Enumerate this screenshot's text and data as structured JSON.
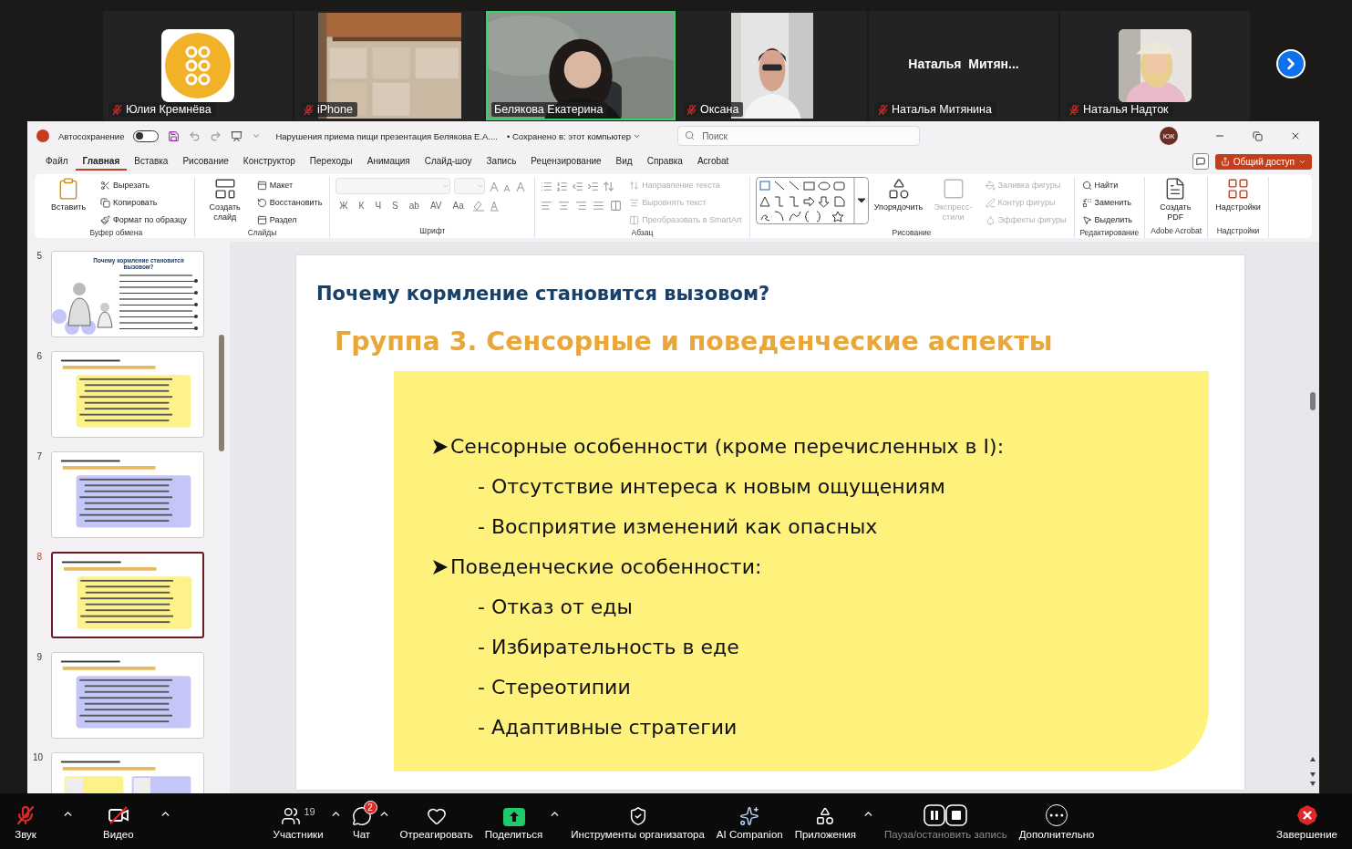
{
  "participants": [
    {
      "name": "Юлия Кремнёва",
      "kind": "logo_avatar",
      "muted": true,
      "speaking": false
    },
    {
      "name": "iPhone",
      "kind": "wide_camera",
      "muted": true,
      "speaking": false
    },
    {
      "name": "Белякова Екатерина",
      "kind": "video",
      "muted": false,
      "speaking": true
    },
    {
      "name": "Оксана",
      "kind": "narrow_camera",
      "muted": true,
      "speaking": false
    },
    {
      "name": "Наталья Митянина",
      "kind": "name_only",
      "display_name": "Наталья  Митян...",
      "muted": true,
      "speaking": false
    },
    {
      "name": "Наталья Надток",
      "kind": "photo_avatar",
      "muted": true,
      "speaking": false
    }
  ],
  "powerpoint": {
    "autosave_label": "Автосохранение",
    "autosave_on": false,
    "doc_title": "Нарушения приема пищи презентация Белякова Е.А....",
    "save_status": "• Сохранено в: этот компьютер",
    "search_placeholder": "Поиск",
    "user_initials": "ЮК",
    "tabs": [
      {
        "label": "Файл",
        "selected": false
      },
      {
        "label": "Главная",
        "selected": true
      },
      {
        "label": "Вставка",
        "selected": false
      },
      {
        "label": "Рисование",
        "selected": false
      },
      {
        "label": "Конструктор",
        "selected": false
      },
      {
        "label": "Переходы",
        "selected": false
      },
      {
        "label": "Анимация",
        "selected": false
      },
      {
        "label": "Слайд-шоу",
        "selected": false
      },
      {
        "label": "Запись",
        "selected": false
      },
      {
        "label": "Рецензирование",
        "selected": false
      },
      {
        "label": "Вид",
        "selected": false
      },
      {
        "label": "Справка",
        "selected": false
      },
      {
        "label": "Acrobat",
        "selected": false
      }
    ],
    "share_button": "Общий доступ",
    "ribbon_groups": [
      {
        "kind": "standard",
        "label": "Буфер обмена",
        "items": [
          {
            "kind": "large",
            "label": "Вставить",
            "disabled": false
          },
          {
            "kind": "small",
            "label": "Вырезать",
            "disabled": false
          },
          {
            "kind": "small",
            "label": "Копировать",
            "disabled": false
          },
          {
            "kind": "small",
            "label": "Формат по образцу",
            "disabled": false
          }
        ]
      },
      {
        "kind": "standard",
        "label": "Слайды",
        "items": [
          {
            "kind": "large",
            "label": "Создать слайд",
            "disabled": false
          },
          {
            "kind": "small",
            "label": "Макет",
            "disabled": false
          },
          {
            "kind": "small",
            "label": "Восстановить",
            "disabled": false
          },
          {
            "kind": "small",
            "label": "Раздел",
            "disabled": false
          }
        ]
      },
      {
        "kind": "font",
        "label": "Шрифт",
        "format_buttons": [
          "Ж",
          "К",
          "Ч",
          "S",
          "ab",
          "AV",
          "Aa"
        ]
      },
      {
        "kind": "paragraph",
        "label": "Абзац",
        "items": [
          {
            "kind": "small",
            "label": "Направление текста",
            "disabled": true
          },
          {
            "kind": "small",
            "label": "Выровнять текст",
            "disabled": true
          },
          {
            "kind": "small",
            "label": "Преобразовать в SmartArt",
            "disabled": true
          }
        ]
      },
      {
        "kind": "drawing",
        "label": "Рисование",
        "items": [
          {
            "kind": "large",
            "label": "Упорядочить",
            "disabled": false
          },
          {
            "kind": "large",
            "label": "Экспресс-стили",
            "disabled": true
          },
          {
            "kind": "small",
            "label": "Заливка фигуры",
            "disabled": true
          },
          {
            "kind": "small",
            "label": "Контур фигуры",
            "disabled": true
          },
          {
            "kind": "small",
            "label": "Эффекты фигуры",
            "disabled": true
          }
        ]
      },
      {
        "kind": "standard",
        "label": "Редактирование",
        "items": [
          {
            "kind": "small",
            "label": "Найти",
            "disabled": false
          },
          {
            "kind": "small",
            "label": "Заменить",
            "disabled": false
          },
          {
            "kind": "small",
            "label": "Выделить",
            "disabled": false
          }
        ]
      },
      {
        "kind": "standard",
        "label": "Adobe Acrobat",
        "items": [
          {
            "kind": "large",
            "label": "Создать PDF",
            "disabled": false
          }
        ]
      },
      {
        "kind": "standard",
        "label": "Надстройки",
        "items": [
          {
            "kind": "large",
            "label": "Надстройки",
            "disabled": false
          }
        ]
      }
    ],
    "thumbnails": [
      {
        "number": "5",
        "kind": "intro",
        "title": "Почему кормление становится вызовом?",
        "selected": false
      },
      {
        "number": "6",
        "kind": "box",
        "color": "#fdf18a",
        "selected": false
      },
      {
        "number": "7",
        "kind": "box",
        "color": "#c3c6f7",
        "selected": false
      },
      {
        "number": "8",
        "kind": "box",
        "color": "#fdf18a",
        "selected": true
      },
      {
        "number": "9",
        "kind": "box",
        "color": "#c3c6f7",
        "selected": false
      },
      {
        "number": "10",
        "kind": "split",
        "selected": false
      }
    ],
    "slide": {
      "title": "Почему кормление становится вызовом?",
      "heading": "Группа 3. Сенсорные и поведенческие аспекты",
      "bullets": [
        {
          "kind": "main",
          "text": "Сенсорные особенности (кроме перечисленных в I):"
        },
        {
          "kind": "sub",
          "text": "- Отсутствие интереса к новым ощущениям"
        },
        {
          "kind": "sub",
          "text": "- Восприятие изменений как опасных"
        },
        {
          "kind": "main",
          "text": "Поведенческие особенности:"
        },
        {
          "kind": "sub",
          "text": "- Отказ от еды"
        },
        {
          "kind": "sub",
          "text": "- Избирательность в еде"
        },
        {
          "kind": "sub",
          "text": "- Стереотипии"
        },
        {
          "kind": "sub",
          "text": "- Адаптивные стратегии"
        }
      ]
    }
  },
  "toolbar": {
    "left": [
      {
        "label": "Звук",
        "caret": true,
        "disabled": false
      },
      {
        "label": "Видео",
        "caret": true,
        "disabled": false
      }
    ],
    "center": [
      {
        "label": "Участники",
        "count": "19",
        "caret": true,
        "disabled": false
      },
      {
        "label": "Чат",
        "badge": "2",
        "caret": true,
        "disabled": false
      },
      {
        "label": "Отреагировать",
        "caret": false,
        "disabled": false
      },
      {
        "label": "Поделиться",
        "caret": true,
        "disabled": false
      },
      {
        "label": "Инструменты организатора",
        "caret": false,
        "disabled": false
      },
      {
        "label": "AI Companion",
        "caret": false,
        "disabled": false
      },
      {
        "label": "Приложения",
        "caret": true,
        "disabled": false
      },
      {
        "label": "Пауза/остановить запись",
        "caret": false,
        "disabled": true
      },
      {
        "label": "Дополнительно",
        "caret": false,
        "disabled": false
      }
    ],
    "right": [
      {
        "label": "Завершение",
        "caret": false,
        "disabled": false
      }
    ]
  }
}
